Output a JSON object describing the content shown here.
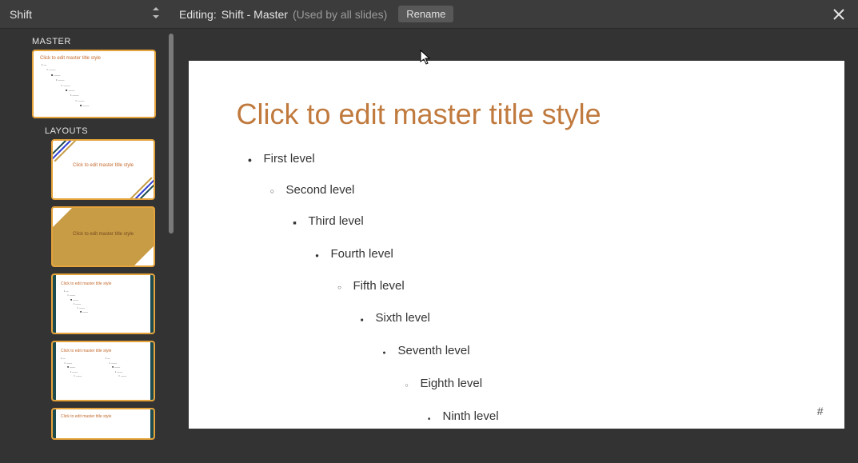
{
  "theme": {
    "name": "Shift"
  },
  "header": {
    "editing_prefix": "Editing:",
    "editing_target": "Shift - Master",
    "usage": "(Used by all slides)",
    "rename_label": "Rename"
  },
  "sidebar": {
    "master_label": "MASTER",
    "layouts_label": "LAYOUTS",
    "master_thumb_title": "Click to edit master title style",
    "layout_thumbs": [
      {
        "title": "Click to edit master title style",
        "subtitle": ""
      },
      {
        "title": "Click to edit master title style"
      },
      {
        "title": "Click to edit master title style"
      },
      {
        "title": "Click to edit master title style"
      },
      {
        "title": "Click to edit master title style"
      }
    ]
  },
  "slide": {
    "title": "Click to edit master title style",
    "levels": [
      "First level",
      "Second level",
      "Third level",
      "Fourth level",
      "Fifth level",
      "Sixth level",
      "Seventh level",
      "Eighth level",
      "Ninth level"
    ],
    "page_number": "#"
  },
  "colors": {
    "accent": "#c07a3e",
    "thumb_border": "#e5a33b",
    "gold": "#c79c45",
    "teal": "#1b4a4f"
  }
}
